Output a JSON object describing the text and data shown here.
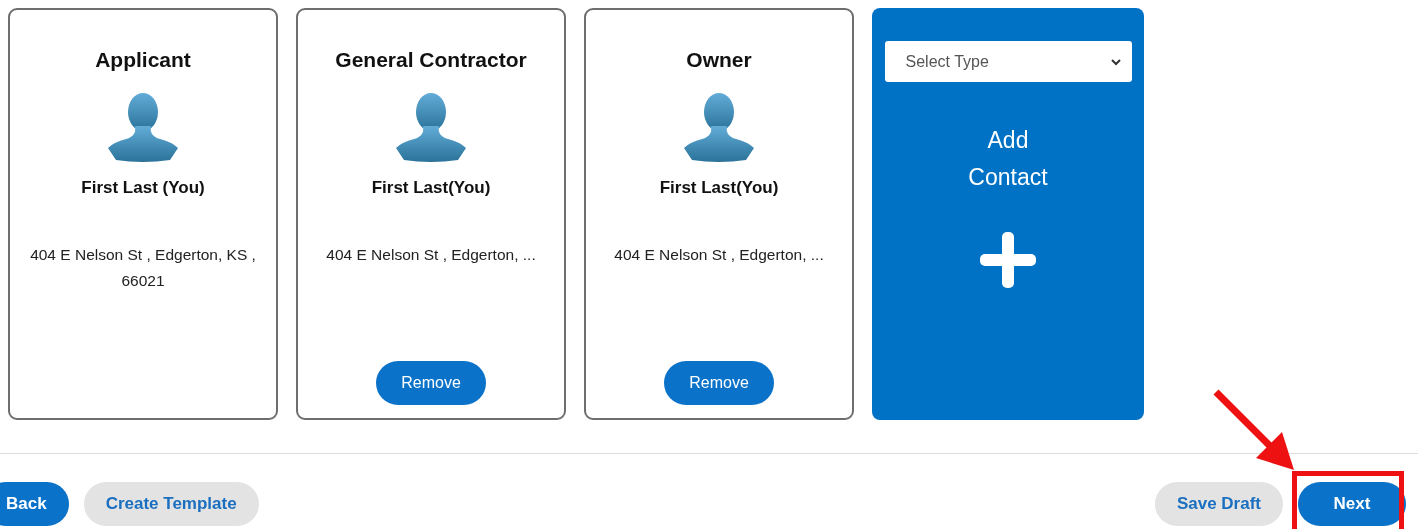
{
  "cards": [
    {
      "kind": "contact",
      "role": "Applicant",
      "name": "First Last (You)",
      "address": "404 E Nelson St , Edgerton, KS , 66021",
      "removable": false
    },
    {
      "kind": "contact",
      "role": "General Contractor",
      "name": "First Last(You)",
      "address": "404 E Nelson St , Edgerton, ...",
      "removable": true,
      "remove_label": "Remove"
    },
    {
      "kind": "contact",
      "role": "Owner",
      "name": "First Last(You)",
      "address": "404 E Nelson St , Edgerton, ...",
      "removable": true,
      "remove_label": "Remove"
    },
    {
      "kind": "add",
      "select": {
        "placeholder": "Select Type"
      },
      "label": "Add Contact"
    }
  ],
  "footer": {
    "left_buttons": [
      {
        "label": "Back",
        "kind": "primary"
      },
      {
        "label": "Create Template",
        "kind": "secondary"
      }
    ],
    "right_buttons": [
      {
        "label": "Save Draft",
        "kind": "secondary",
        "highlighted": false
      },
      {
        "label": "Next",
        "kind": "primary",
        "highlighted": true
      }
    ]
  }
}
